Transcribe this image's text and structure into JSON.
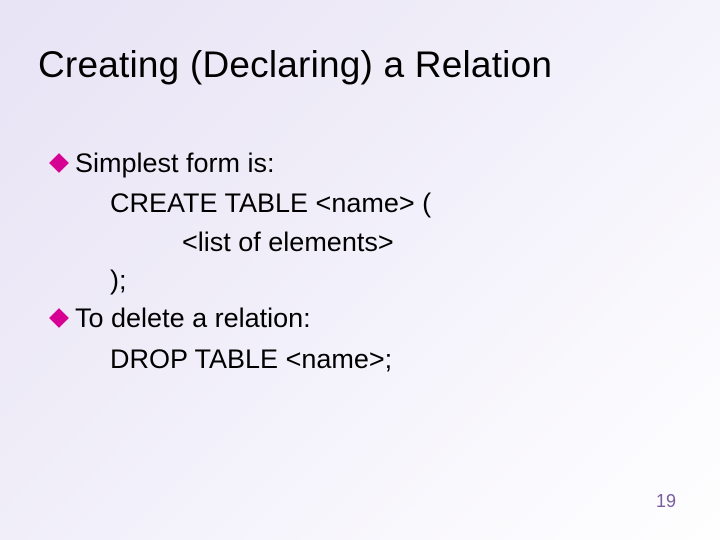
{
  "slide": {
    "title": "Creating (Declaring) a Relation",
    "bullets": [
      {
        "text": "Simplest form is:"
      },
      {
        "text": "To delete a relation:"
      }
    ],
    "code": {
      "create_line": "CREATE TABLE <name> (",
      "list_line": "<list of elements>",
      "close_line": ");",
      "drop_line": "DROP TABLE <name>;"
    },
    "page_number": "19"
  }
}
